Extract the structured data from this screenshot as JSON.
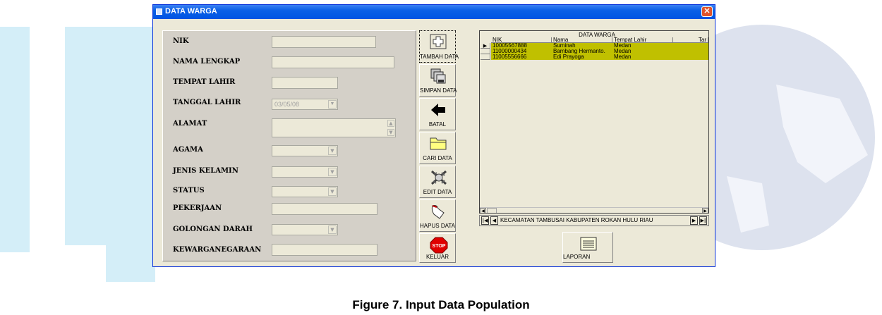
{
  "window": {
    "title": "DATA WARGA",
    "close_label": "✕"
  },
  "form": {
    "nik": "NIK",
    "nama": "NAMA LENGKAP",
    "tempat_lahir": "TEMPAT LAHIR",
    "tanggal_lahir": "TANGGAL LAHIR",
    "tanggal_value": "03/05/08",
    "alamat": "ALAMAT",
    "agama": "AGAMA",
    "jenis_kelamin": "JENIS KELAMIN",
    "status": "STATUS",
    "pekerjaan": "PEKERJAAN",
    "golongan_darah": "GOLONGAN DARAH",
    "kewarganegaraan": "KEWARGANEGARAAN"
  },
  "buttons": {
    "tambah": "TAMBAH DATA",
    "simpan": "SIMPAN DATA",
    "batal": "BATAL",
    "cari": "CARI DATA",
    "edit": "EDIT DATA",
    "hapus": "HAPUS DATA",
    "keluar": "KELUAR",
    "laporan": "LAPORAN",
    "stop_text": "STOP"
  },
  "grid": {
    "caption": "DATA WARGA",
    "columns": [
      "NIK",
      "Nama",
      "Tempat Lahir",
      "Tar"
    ],
    "rows": [
      [
        "10005567888",
        "Suminah",
        "Medan",
        ""
      ],
      [
        "11000000434",
        "Bambang Hermanto.",
        "Medan",
        ""
      ],
      [
        "11005556666",
        "Edi Prayoga",
        "Medan",
        ""
      ]
    ],
    "row_color": "#c0c000"
  },
  "navigator": {
    "caption": "KECAMATAN TAMBUSAI KABUPATEN ROKAN HULU RIAU"
  },
  "figure_caption": "Figure 7. Input Data Population"
}
